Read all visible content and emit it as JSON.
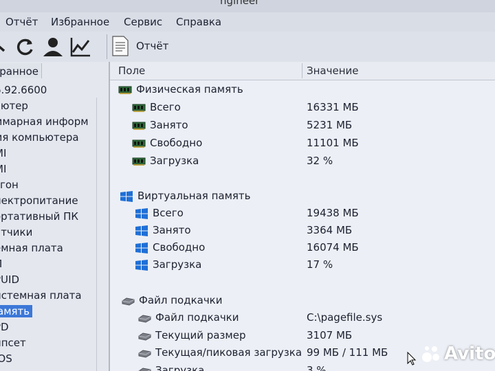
{
  "window": {
    "title_fragment": "ngineer"
  },
  "menu": [
    "Отчёт",
    "Избранное",
    "Сервис",
    "Справка"
  ],
  "toolbar": {
    "icons": [
      "arrow-icon",
      "refresh-icon",
      "user-icon",
      "chart-icon"
    ],
    "report_label": "Отчёт"
  },
  "left_panel": {
    "header": "бранное",
    "items": [
      "6.92.6600",
      "ьютер",
      "ммарная информ",
      "мя компьютера",
      "МI",
      "МI",
      "згон",
      "лектропитание",
      "ортативный ПК",
      "атчики",
      "емная плата",
      "П",
      "PUID",
      "истемная плата",
      "амять",
      "PD",
      "ипсет",
      "IOS"
    ],
    "selected_index": 14
  },
  "columns": {
    "field": "Поле",
    "value": "Значение"
  },
  "sections": [
    {
      "title": "Физическая память",
      "icon": "memory-module-icon",
      "rows": [
        {
          "field": "Всего",
          "value": "16331 МБ"
        },
        {
          "field": "Занято",
          "value": "5231 МБ"
        },
        {
          "field": "Свободно",
          "value": "11101 МБ"
        },
        {
          "field": "Загрузка",
          "value": "32 %"
        }
      ]
    },
    {
      "title": "Виртуальная память",
      "icon": "windows-logo-icon",
      "rows": [
        {
          "field": "Всего",
          "value": "19438 МБ"
        },
        {
          "field": "Занято",
          "value": "3364 МБ"
        },
        {
          "field": "Свободно",
          "value": "16074 МБ"
        },
        {
          "field": "Загрузка",
          "value": "17 %"
        }
      ]
    },
    {
      "title": "Файл подкачки",
      "icon": "drive-icon",
      "rows": [
        {
          "field": "Файл подкачки",
          "value": "C:\\pagefile.sys"
        },
        {
          "field": "Текущий размер",
          "value": "3107 МБ"
        },
        {
          "field": "Текущая/пиковая загрузка",
          "value": "99 МБ / 111 МБ"
        },
        {
          "field": "Загрузка",
          "value": "3 %"
        }
      ]
    }
  ],
  "watermark": {
    "text": "Avito"
  },
  "colors": {
    "selection": "#3c78d8",
    "windows_blue": "#1f6fd6",
    "memory_green": "#2f6a3a"
  }
}
